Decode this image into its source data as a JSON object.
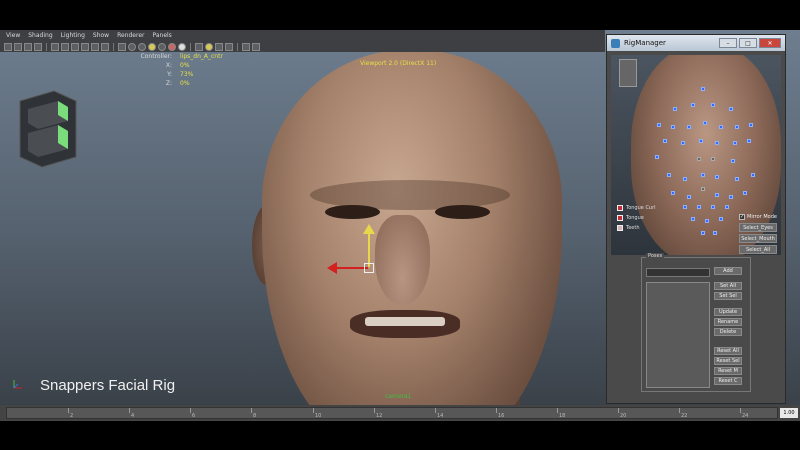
{
  "menu": [
    "View",
    "Shading",
    "Lighting",
    "Show",
    "Renderer",
    "Panels"
  ],
  "hud": {
    "controller_label": "Controller:",
    "controller_value": "lips_dn_A_cntr",
    "x_label": "X:",
    "x_value": "0%",
    "y_label": "Y:",
    "y_value": "73%",
    "z_label": "Z:",
    "z_value": "0%"
  },
  "viewport_label": "Viewport 2.0 (DirectX 11)",
  "camera_label": "camera1",
  "caption": "Snappers Facial Rig",
  "timeline": {
    "ticks": [
      "2",
      "4",
      "6",
      "8",
      "10",
      "12",
      "14",
      "16",
      "18",
      "20",
      "22",
      "24"
    ],
    "current": "1.00"
  },
  "rig_manager": {
    "title": "RigManager",
    "legend": [
      "Tongue Curl",
      "Tongue",
      "Teeth"
    ],
    "mirror_mode": "Mirror Mode",
    "select_buttons": [
      "Select_Eyes",
      "Select_Mouth",
      "Select_All"
    ],
    "poses_label": "Poses",
    "pose_buttons": [
      "Add",
      "Set All",
      "Set Sel",
      "Update",
      "Rename",
      "Delete",
      "Reset All",
      "Reset Sel",
      "Reset M",
      "Reset C"
    ]
  },
  "colors": {
    "accent_blue": "#2d6cff",
    "manip_red": "#d42020",
    "manip_yellow": "#e6d84a"
  }
}
